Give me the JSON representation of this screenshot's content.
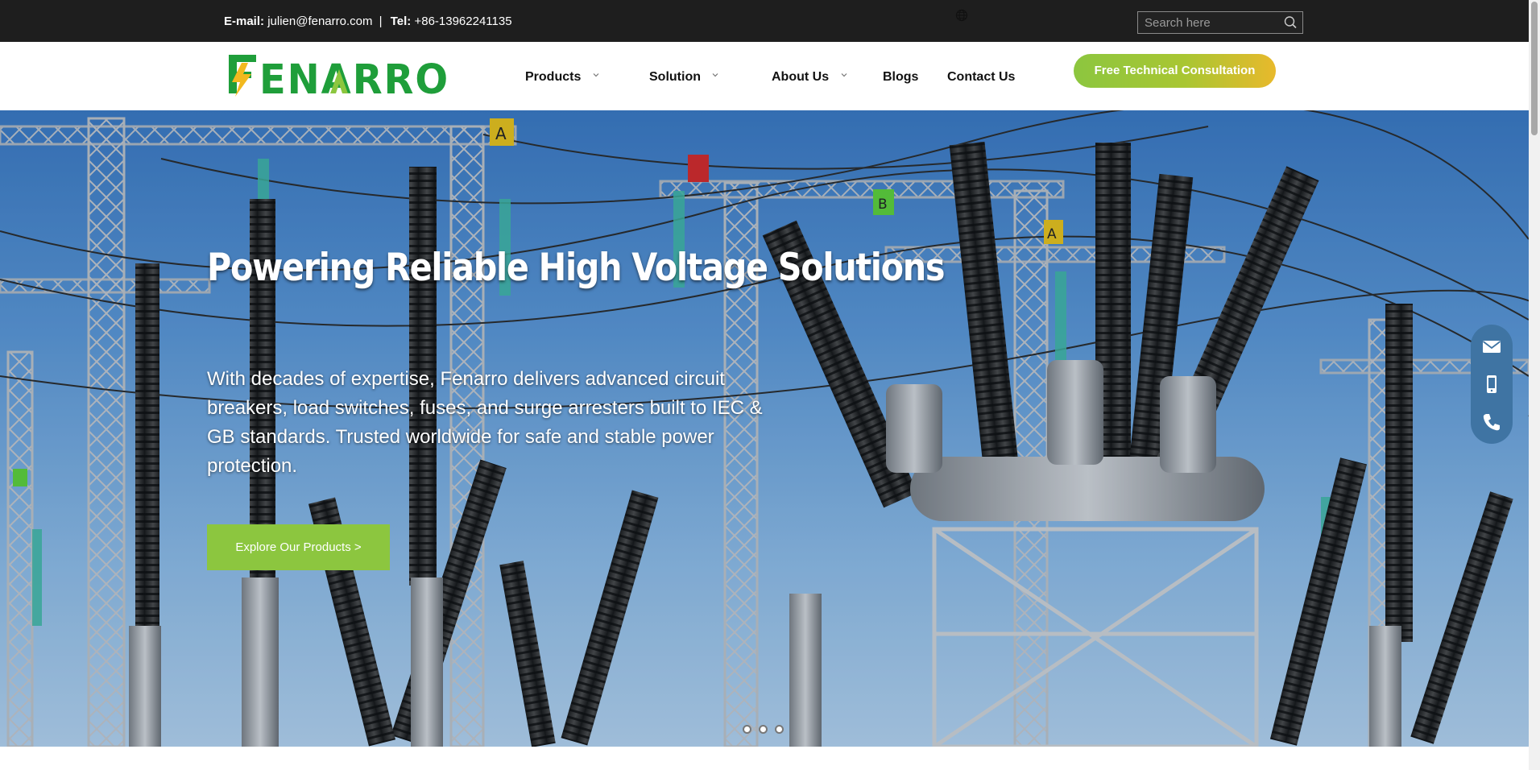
{
  "topbar": {
    "email_label": "E-mail:",
    "email_value": "julien@fenarro.com",
    "separator": "|",
    "tel_label": "Tel:",
    "tel_value": "+86-13962241135",
    "language_icon": "globe-icon",
    "search": {
      "placeholder": "Search here",
      "icon": "search-icon"
    }
  },
  "logo": {
    "text": "FENARRO",
    "brand_green": "#1f9e3a",
    "lime": "#8cc63f",
    "bolt_yellow": "#f2b91f"
  },
  "nav": {
    "items": [
      {
        "label": "Products",
        "has_dropdown": true
      },
      {
        "label": "Solution",
        "has_dropdown": true
      },
      {
        "label": "About Us",
        "has_dropdown": true
      },
      {
        "label": "Blogs",
        "has_dropdown": false
      },
      {
        "label": "Contact Us",
        "has_dropdown": false
      }
    ],
    "cta_label": "Free Technical Consultation"
  },
  "hero": {
    "title": "Powering Reliable High Voltage Solutions",
    "description": "With decades of expertise, Fenarro delivers advanced circuit breakers, load switches, fuses, and surge arresters built to IEC & GB standards. Trusted worldwide for safe and stable power protection.",
    "button_label": "Explore Our Products >",
    "slide_count": 3,
    "active_slide": 1,
    "image": "high-voltage-substation-photo"
  },
  "floating_contact": [
    "mail-icon",
    "mobile-phone-icon",
    "phone-icon"
  ],
  "colors": {
    "topbar_bg": "#1e1e1e",
    "accent_green": "#8cc63f",
    "cta_gradient_end": "#e8b92c",
    "float_bar": "#3f74a3"
  }
}
